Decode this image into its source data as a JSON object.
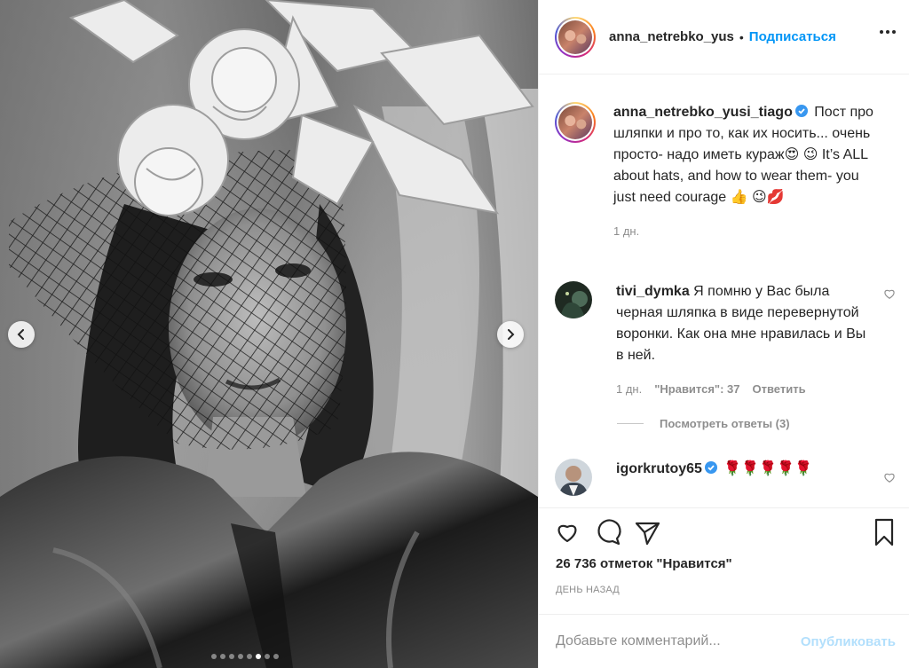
{
  "post": {
    "author": {
      "username": "anna_netrebko_yus",
      "separator": "•",
      "follow_label": "Подписаться",
      "avatar_icon": "avatar-photo"
    },
    "caption": {
      "username": "anna_netrebko_yusi_tiago",
      "verified": true,
      "text": "Пост про шляпки и про то, как их носить... очень просто- надо иметь кураж😍 😉 It’s ALL about hats, and how to wear them- you just need courage 👍 😉💋",
      "time": "1 дн."
    },
    "comments": [
      {
        "username": "tivi_dymka",
        "verified": false,
        "text": "Я помню у Вас была черная шляпка в виде перевернутой воронки. Как она мне нравилась и Вы в ней.",
        "time": "1 дн.",
        "likes_label": "\"Нравится\": 37",
        "reply_label": "Ответить",
        "view_replies_label": "Посмотреть ответы (3)"
      },
      {
        "username": "igorkrutoy65",
        "verified": true,
        "text": "🌹🌹🌹🌹🌹"
      }
    ],
    "likes_count": "26 736 отметок \"Нравится\"",
    "posted_ago": "ДЕНЬ НАЗАД",
    "add_comment_placeholder": "Добавьте комментарий...",
    "publish_label": "Опубликовать",
    "carousel": {
      "count": 8,
      "active_index": 5
    }
  },
  "colors": {
    "link_blue": "#0095f6",
    "publish_disabled": "#b2dffc",
    "muted": "#8e8e8e",
    "verified_blue": "#3897f0"
  }
}
